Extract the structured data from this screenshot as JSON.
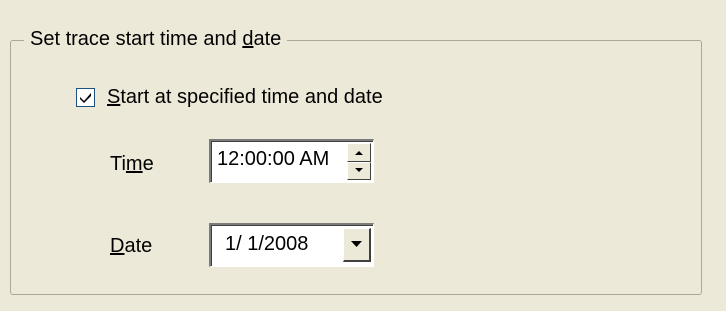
{
  "group": {
    "title_pre": "Set trace start time and ",
    "title_key": "d",
    "title_post": "ate"
  },
  "checkbox": {
    "checked": true,
    "label_key": "S",
    "label_rest": "tart at specified time and date"
  },
  "time": {
    "label_pre": "Ti",
    "label_key": "m",
    "label_post": "e",
    "value": "12:00:00 AM"
  },
  "date": {
    "label_key": "D",
    "label_rest": "ate",
    "value": "1/ 1/2008"
  },
  "icons": {
    "checkmark": "checkmark-icon",
    "spin_up": "arrow-up-icon",
    "spin_down": "arrow-down-icon",
    "dropdown": "dropdown-arrow-icon"
  },
  "colors": {
    "background": "#ece9d8",
    "group_border": "#aca899",
    "checkbox_border": "#1c5180"
  }
}
